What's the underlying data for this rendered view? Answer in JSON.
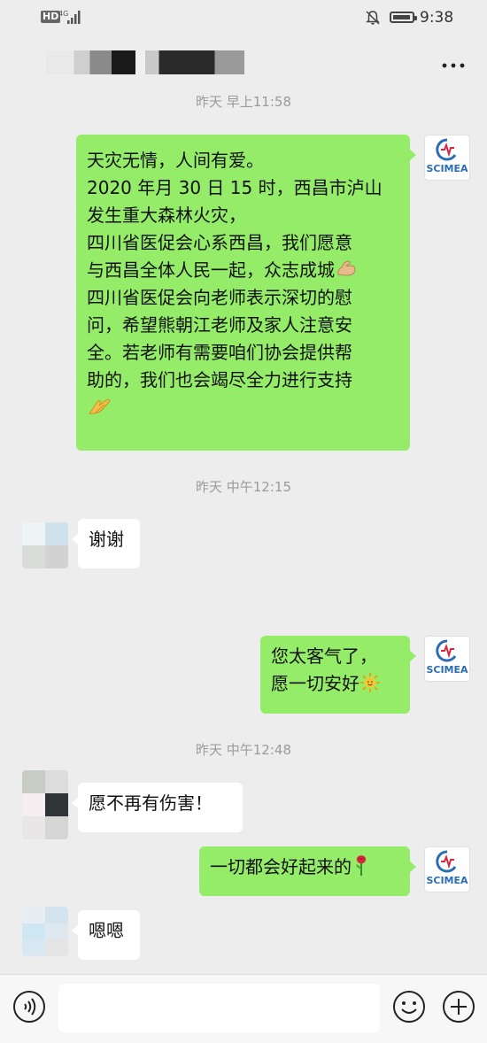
{
  "status_bar": {
    "network_badge": "HD",
    "network_type": "4G",
    "time": "9:38"
  },
  "header": {
    "contact_name_hidden": true,
    "menu_icon": "more-dots-icon"
  },
  "conversation": {
    "timestamps": [
      "昨天 早上11:58",
      "昨天 中午12:15",
      "昨天 中午12:48"
    ],
    "messages": [
      {
        "from": "me",
        "lines": [
          "天灾无情，人间有爱。",
          "2020 年月 30 日 15 时，西昌市泸山",
          "发生重大森林火灾，",
          "四川省医促会心系西昌，我们愿意",
          "与西昌全体人民一起，众志成城",
          "四川省医促会向老师表示深切的慰",
          "问，希望熊朝江老师及家人注意安",
          "全。若老师有需要咱们协会提供帮",
          "助的，我们也会竭尽全力进行支持"
        ],
        "emojis": [
          "flexed-biceps-emoji",
          "folded-hands-emoji"
        ]
      },
      {
        "from": "other",
        "text": "谢谢"
      },
      {
        "from": "me",
        "lines": [
          "您太客气了，",
          "愿一切安好"
        ],
        "emojis": [
          "sun-face-emoji"
        ]
      },
      {
        "from": "other",
        "text": "愿不再有伤害！"
      },
      {
        "from": "me",
        "text": "一切都会好起来的",
        "emojis": [
          "rose-emoji"
        ]
      },
      {
        "from": "other",
        "text": "嗯嗯"
      }
    ]
  },
  "self_avatar": {
    "logo_text": "SCIMEA",
    "accent": "#d7263d",
    "logo_blue": "#2a6db5"
  },
  "input_bar": {
    "placeholder": "",
    "icons": [
      "voice-icon",
      "emoji-icon",
      "plus-icon"
    ]
  },
  "colors": {
    "background": "#ededed",
    "my_bubble": "#95ec69",
    "other_bubble": "#ffffff",
    "timestamp": "#9b9b9b"
  }
}
